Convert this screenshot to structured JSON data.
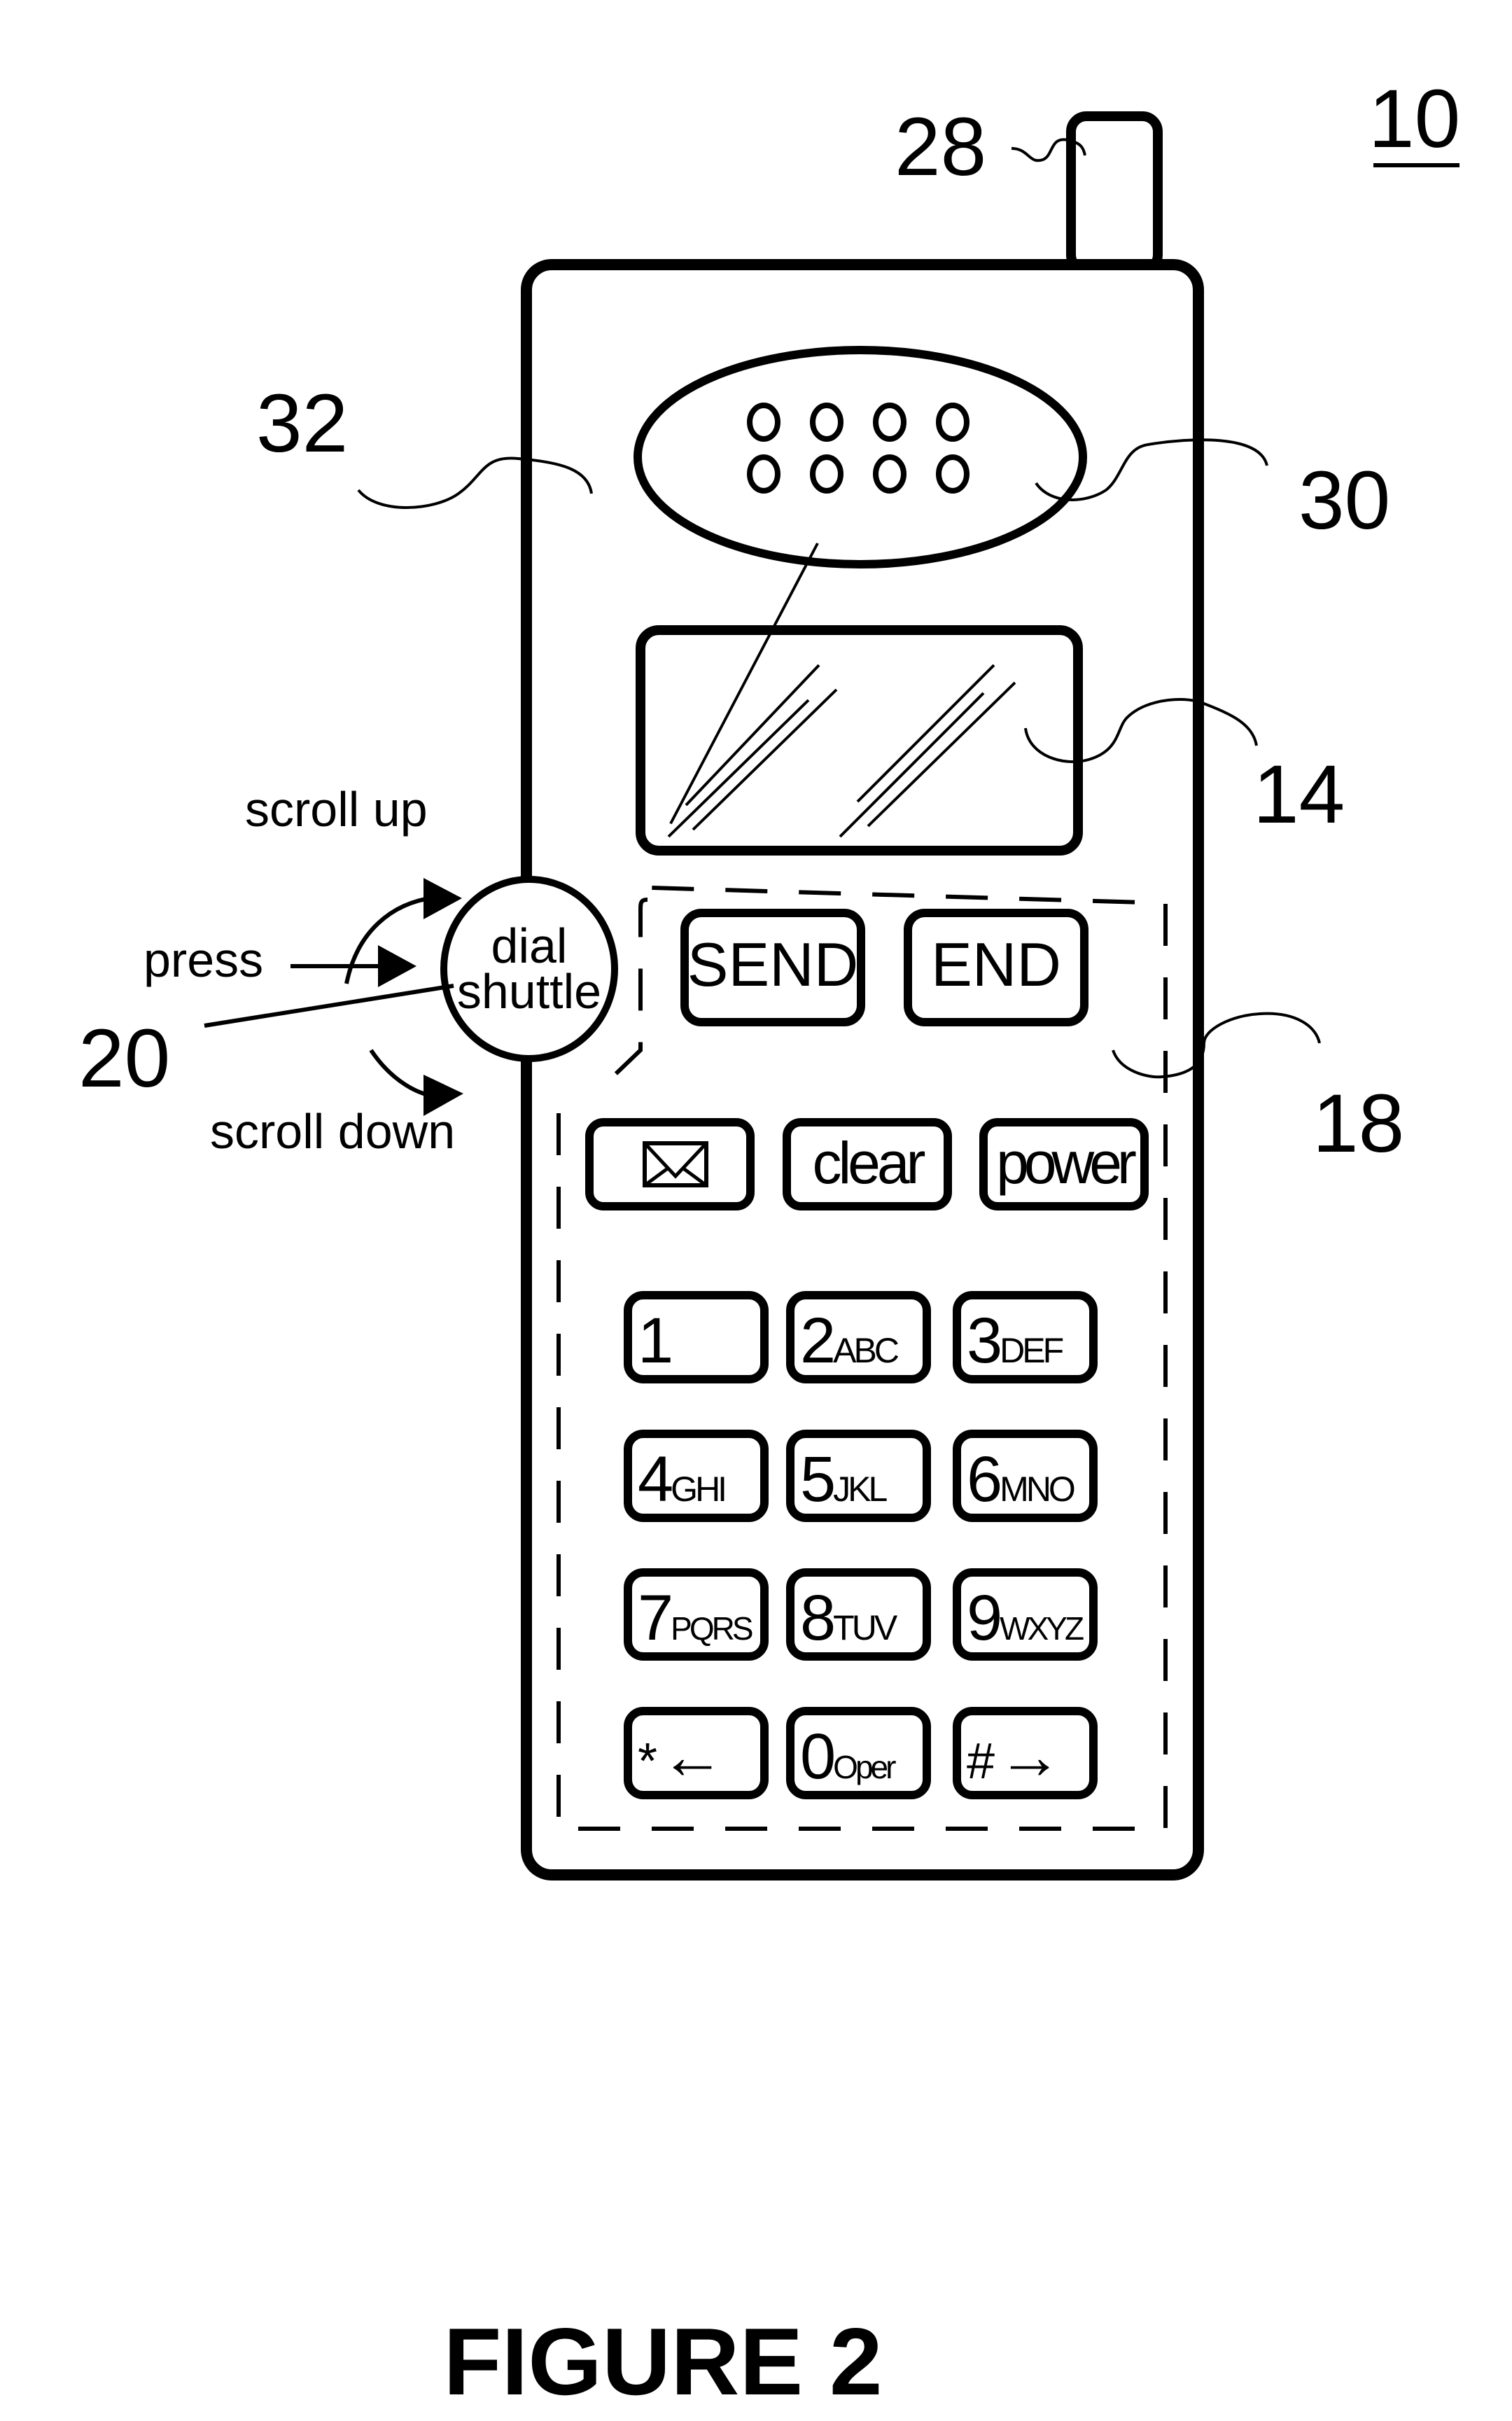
{
  "figure": {
    "title": "FIGURE 2",
    "device_ref": "10"
  },
  "reference_labels": {
    "antenna": "28",
    "housing": "32",
    "speaker": "30",
    "display": "14",
    "dial_shuttle": "20",
    "keypad": "18"
  },
  "dial_shuttle": {
    "line1": "dial",
    "line2": "shuttle",
    "actions": {
      "scroll_up": "scroll up",
      "press": "press",
      "scroll_down": "scroll down"
    }
  },
  "call_keys": {
    "send": "SEND",
    "end": "END"
  },
  "function_keys": {
    "message_icon": "envelope-icon",
    "clear": "clear",
    "power": "power"
  },
  "keypad": [
    {
      "digit": "1",
      "letters": ""
    },
    {
      "digit": "2",
      "letters": "ABC"
    },
    {
      "digit": "3",
      "letters": "DEF"
    },
    {
      "digit": "4",
      "letters": "GHI"
    },
    {
      "digit": "5",
      "letters": "JKL"
    },
    {
      "digit": "6",
      "letters": "MNO"
    },
    {
      "digit": "7",
      "letters": "PQRS"
    },
    {
      "digit": "8",
      "letters": "TUV"
    },
    {
      "digit": "9",
      "letters": "WXYZ"
    },
    {
      "digit": "*",
      "letters": "←"
    },
    {
      "digit": "0",
      "letters": "Oper"
    },
    {
      "digit": "#",
      "letters": "→"
    }
  ]
}
